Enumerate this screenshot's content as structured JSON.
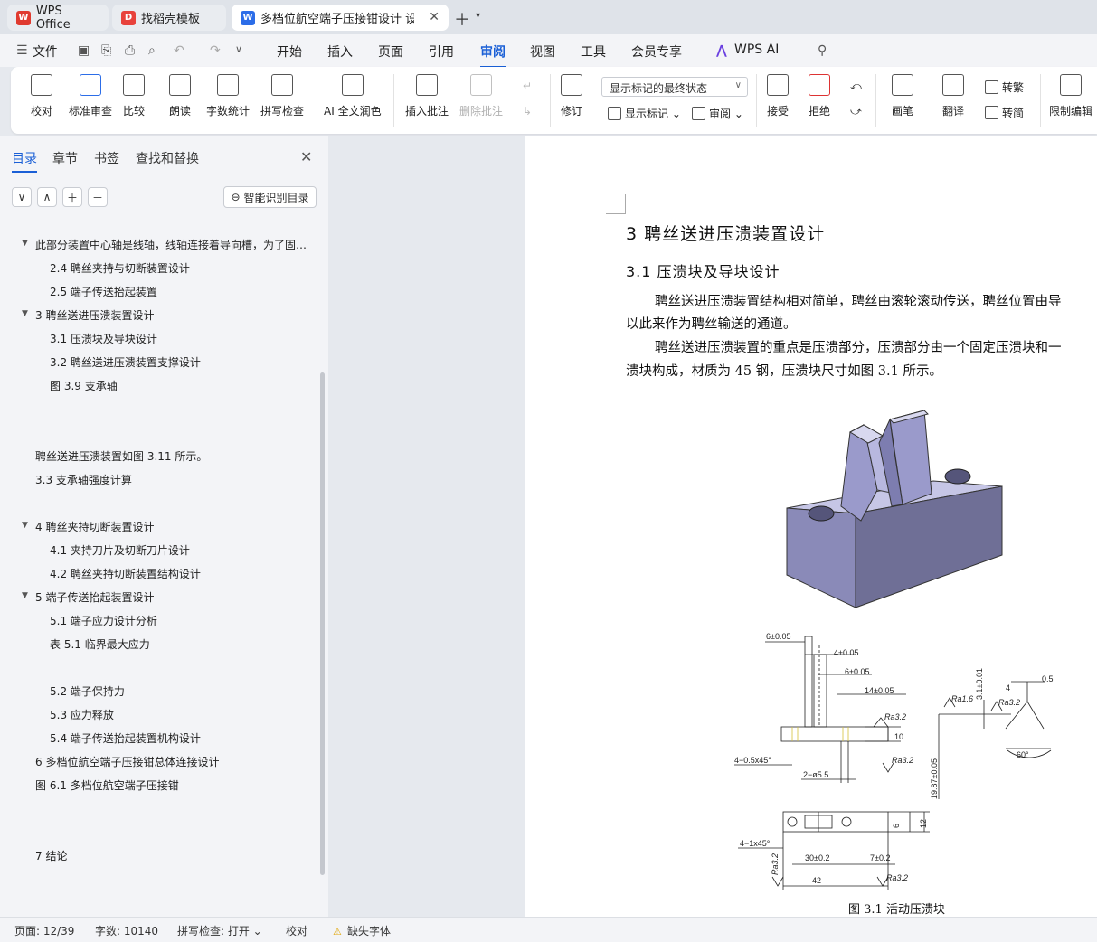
{
  "tabs": [
    {
      "label": "WPS Office",
      "icon": "wps-logo-icon"
    },
    {
      "label": "找稻壳模板",
      "icon": "docer-icon"
    },
    {
      "label": "多档位航空端子压接钳设计 设",
      "icon": "word-doc-icon"
    }
  ],
  "menu": {
    "file": "文件",
    "items": [
      "开始",
      "插入",
      "页面",
      "引用",
      "审阅",
      "视图",
      "工具",
      "会员专享",
      "WPS AI"
    ],
    "active": "审阅"
  },
  "ribbon": {
    "proofread": "校对",
    "standard_review": "标准审查",
    "compare": "比较",
    "read_aloud": "朗读",
    "word_count": "字数统计",
    "spell_check": "拼写检查",
    "ai_polish": "AI 全文润色",
    "insert_comment": "插入批注",
    "delete_comment": "删除批注",
    "track_changes": "修订",
    "markup_mode": "显示标记的最终状态",
    "show_markup": "显示标记",
    "review_pane": "审阅",
    "accept": "接受",
    "reject": "拒绝",
    "pen": "画笔",
    "translate": "翻译",
    "to_traditional": "转繁",
    "to_simplified": "转简",
    "restrict_edit": "限制编辑"
  },
  "nav": {
    "tabs": [
      "目录",
      "章节",
      "书签",
      "查找和替换"
    ],
    "active_tab": "目录",
    "smart_toc": "智能识别目录",
    "toc": [
      {
        "text": "此部分装置中心轴是线轴，线轴连接着导向槽，为了固…",
        "level": 0,
        "arrow": true
      },
      {
        "text": "2.4   聘丝夹持与切断装置设计",
        "level": 1,
        "arrow": false
      },
      {
        "text": "2.5   端子传送抬起装置",
        "level": 1,
        "arrow": false
      },
      {
        "text": "3   聘丝送进压溃装置设计",
        "level": 0,
        "arrow": true
      },
      {
        "text": "3.1   压溃块及导块设计",
        "level": 1,
        "arrow": false
      },
      {
        "text": "3.2   聘丝送进压溃装置支撑设计",
        "level": 1,
        "arrow": false
      },
      {
        "text": "图 3.9   支承轴",
        "level": 1,
        "arrow": false
      },
      {
        "text": "聘丝送进压溃装置如图 3.11 所示。",
        "level": 0,
        "arrow": false
      },
      {
        "text": "3.3   支承轴强度计算",
        "level": 0,
        "arrow": false
      },
      {
        "text": "4   聘丝夹持切断装置设计",
        "level": 0,
        "arrow": true
      },
      {
        "text": "4.1   夹持刀片及切断刀片设计",
        "level": 1,
        "arrow": false
      },
      {
        "text": "4.2   聘丝夹持切断装置结构设计",
        "level": 1,
        "arrow": false
      },
      {
        "text": "5   端子传送抬起装置设计",
        "level": 0,
        "arrow": true
      },
      {
        "text": "5.1   端子应力设计分析",
        "level": 1,
        "arrow": false
      },
      {
        "text": "表 5.1 临界最大应力",
        "level": 1,
        "arrow": false
      },
      {
        "text": "5.2   端子保持力",
        "level": 1,
        "arrow": false
      },
      {
        "text": "5.3   应力释放",
        "level": 1,
        "arrow": false
      },
      {
        "text": "5.4   端子传送抬起装置机构设计",
        "level": 1,
        "arrow": false
      },
      {
        "text": "6   多档位航空端子压接钳总体连接设计",
        "level": 0,
        "arrow": false
      },
      {
        "text": "图 6.1   多档位航空端子压接钳",
        "level": 0,
        "arrow": false
      },
      {
        "text": "7   结论",
        "level": 0,
        "arrow": false
      }
    ]
  },
  "doc": {
    "h1": "3   聘丝送进压溃装置设计",
    "h2": "3.1   压溃块及导块设计",
    "p1a": "聘丝送进压溃装置结构相对简单，聘丝由滚轮滚动传送，聘丝位置由导",
    "p1b": "以此来作为聘丝输送的通道。",
    "p2a": "聘丝送进压溃装置的重点是压溃部分，压溃部分由一个固定压溃块和一",
    "p2b": "溃块构成，材质为 45 钢，压溃块尺寸如图 3.1 所示。",
    "caption": "图 3.1   活动压溃块",
    "dims": {
      "d1": "6±0.05",
      "d2": "4±0.05",
      "d3": "6±0.05",
      "d4": "14±0.05",
      "d5": "10",
      "d6": "4−0.5x45°",
      "d7": "2−ø5.5",
      "d8": "Ra3.2",
      "d9": "3.1±0.01",
      "d10": "0.5",
      "d11": "4",
      "d12": "Ra1.6",
      "d13": "60°",
      "d14": "19.87±0.05",
      "d15": "4−1x45°",
      "d16": "30±0.2",
      "d17": "7±0.2",
      "d18": "42",
      "d19": "6",
      "d20": "12"
    }
  },
  "status": {
    "page": "页面: 12/39",
    "words": "字数: 10140",
    "spell": "拼写检查: 打开",
    "proof": "校对",
    "missing_font": "缺失字体"
  },
  "colors": {
    "accent": "#1a5fd6",
    "part_top": "#c6c6e6",
    "part_front": "#6f6f96",
    "part_side": "#8a8ab8"
  }
}
